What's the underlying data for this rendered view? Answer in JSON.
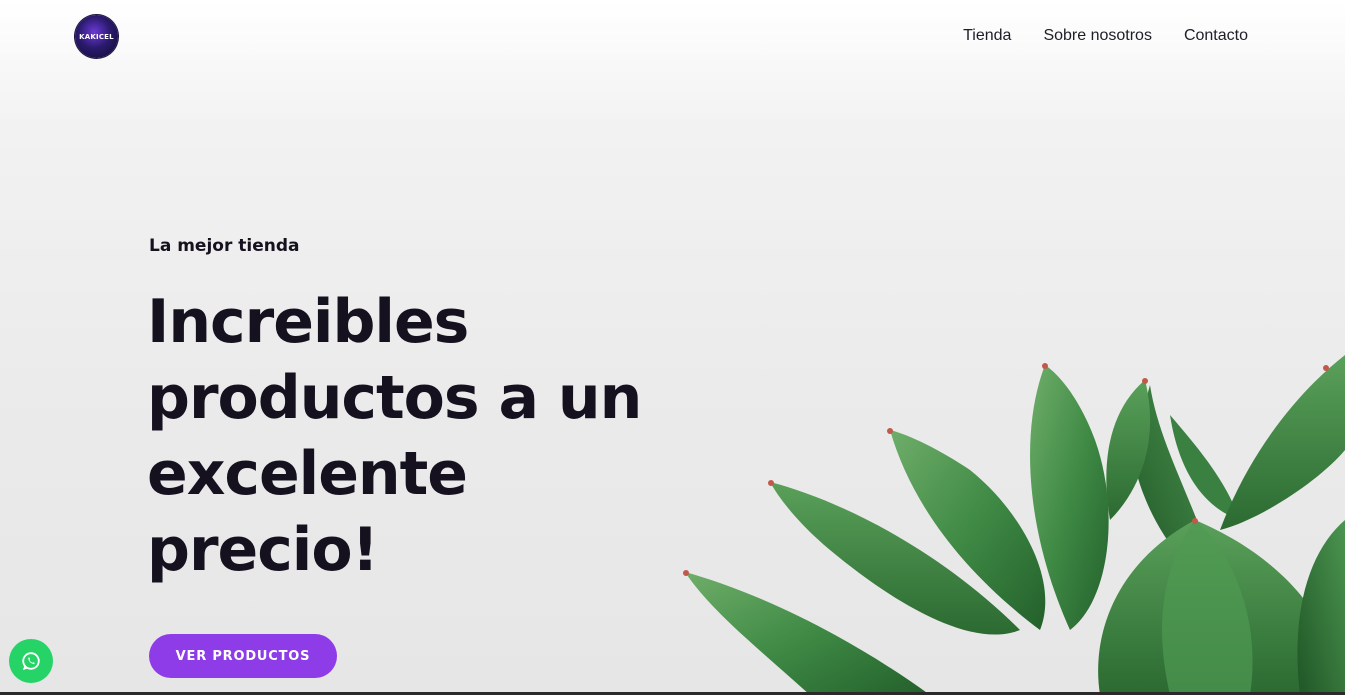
{
  "header": {
    "logo_text": "KAKICEL",
    "nav": [
      {
        "label": "Tienda"
      },
      {
        "label": "Sobre nosotros"
      },
      {
        "label": "Contacto"
      }
    ]
  },
  "hero": {
    "eyebrow": "La mejor tienda",
    "headline": "Increibles productos a un excelente precio!",
    "cta_label": "VER PRODUCTOS"
  },
  "floating": {
    "whatsapp_icon": "whatsapp-icon"
  },
  "colors": {
    "accent": "#8e3be8",
    "text": "#15111f",
    "whatsapp": "#25d366"
  }
}
